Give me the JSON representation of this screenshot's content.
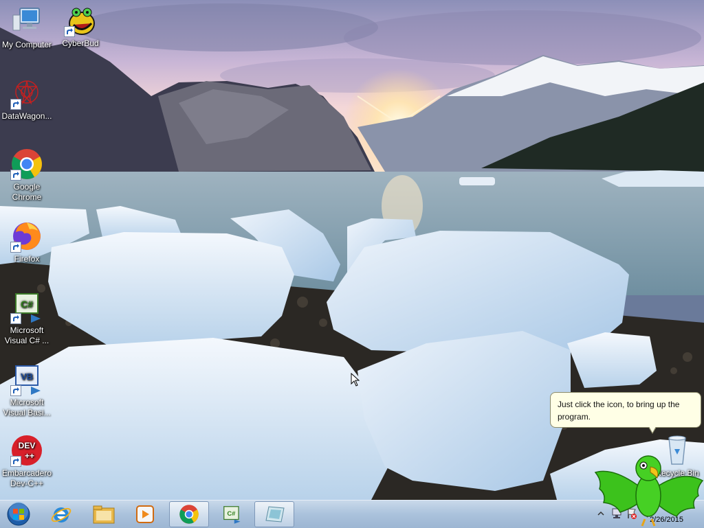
{
  "desktop": {
    "icons": [
      {
        "label": "My Computer",
        "icon": "computer-icon"
      },
      {
        "label": "CyberBud",
        "icon": "cyberbud-icon"
      },
      {
        "label": "DataWagon...",
        "icon": "datawagon-icon"
      },
      {
        "label": "Google Chrome",
        "icon": "chrome-icon"
      },
      {
        "label": "Firefox",
        "icon": "firefox-icon"
      },
      {
        "label": "Microsoft Visual C# ...",
        "icon": "visual-csharp-icon"
      },
      {
        "label": "Microsoft Visual Basi...",
        "icon": "visual-basic-icon"
      },
      {
        "label": "Embarcadero Dev-C++",
        "icon": "devcpp-icon"
      },
      {
        "label": "Recycle Bin",
        "icon": "recycle-bin-icon"
      }
    ],
    "devcpp_badge": "DEV\n++",
    "vb_badge": "VB",
    "cs_badge": "C#"
  },
  "balloon": {
    "text": "Just click the icon, to bring up the program."
  },
  "taskbar": {
    "buttons": [
      {
        "icon": "start-orb-icon"
      },
      {
        "icon": "internet-explorer-icon"
      },
      {
        "icon": "file-explorer-icon"
      },
      {
        "icon": "media-player-icon"
      },
      {
        "icon": "chrome-icon"
      },
      {
        "icon": "visual-csharp-icon"
      },
      {
        "icon": "app-window-icon"
      }
    ],
    "clock_date": "2/26/2015"
  },
  "colors": {
    "taskbar": "#aac2dc",
    "balloon_bg": "#ffffe6",
    "parrot_green": "#3cc21c"
  }
}
